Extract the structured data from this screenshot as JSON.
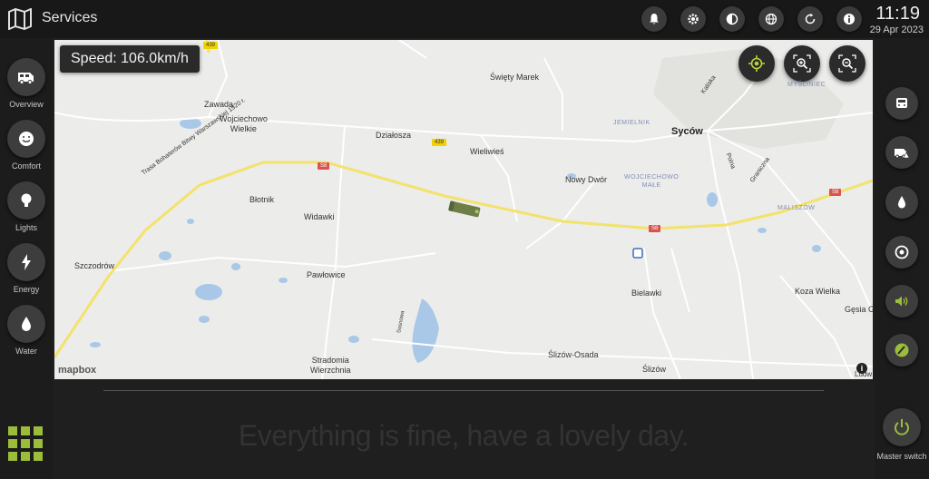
{
  "header": {
    "title": "Services",
    "time": "11:19",
    "date": "29 Apr 2023",
    "buttons": [
      "bell-icon",
      "gear-icon",
      "contrast-icon",
      "globe-icon",
      "refresh-icon",
      "info-icon"
    ]
  },
  "left_nav": [
    {
      "label": "Overview",
      "icon": "camper-icon"
    },
    {
      "label": "Comfort",
      "icon": "smiley-icon"
    },
    {
      "label": "Lights",
      "icon": "lightbulb-icon"
    },
    {
      "label": "Energy",
      "icon": "bolt-icon"
    },
    {
      "label": "Water",
      "icon": "drop-icon"
    }
  ],
  "right_nav": [
    {
      "icon": "camper-front-icon"
    },
    {
      "icon": "camper-warning-icon"
    },
    {
      "icon": "drop-icon"
    },
    {
      "icon": "gauge-icon"
    },
    {
      "icon": "speaker-icon"
    },
    {
      "icon": "paint-icon"
    }
  ],
  "master": {
    "label": "Master switch"
  },
  "map": {
    "speed": "Speed: 106.0km/h",
    "attribution": "mapbox",
    "places": {
      "sycow": "Syców",
      "swiety_marek": "Święty Marek",
      "zawada": "Zawada",
      "wojciechowo_w": "Wojciechowo\nWielkie",
      "dzialosza": "Działosza",
      "wieliwies": "Wieliwieś",
      "nowy_dwor": "Nowy Dwór",
      "wojciechowo_m": "WOJCIECHOWO\nMAŁE",
      "jemielnik": "JEMIELNIK",
      "mysliniec": "MYŚLINIEC",
      "kaliska": "Kaliska",
      "polna": "Polna",
      "graniczna": "Graniczna",
      "maliszow": "MALISZÓW",
      "blotnik": "Błotnik",
      "widawki": "Widawki",
      "szczodrow": "Szczodrów",
      "pawlowice": "Pawłowice",
      "stradomia": "Stradomia\nWierzchnia",
      "bielawki": "Bielawki",
      "koza": "Koza Wielka",
      "gesia": "Gęsia G",
      "slizow_osada": "Ślizów-Osada",
      "slizow": "Ślizów",
      "ludw": "Ludw",
      "sosnowa": "Sosnowa",
      "trasa": "Trasa Bohaterów Bitwy Warszawskiej 1920 r.",
      "rd_439a": "439",
      "rd_439b": "439",
      "rd_s8a": "S8",
      "rd_s8b": "S8",
      "rd_s8c": "S8"
    }
  },
  "footer": {
    "message": "Everything is fine, have a lovely day."
  },
  "colors": {
    "accent": "#9bbd3a",
    "road_main": "#f2dd6c",
    "water": "#a9c8e8"
  }
}
